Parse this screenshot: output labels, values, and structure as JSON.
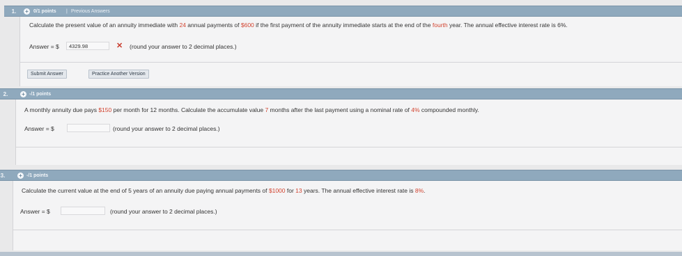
{
  "questions": [
    {
      "number": "1.",
      "points": "0/1 points",
      "separator": "|",
      "previous_answers": "Previous Answers",
      "text_parts": [
        "Calculate the present value of an annuity immediate with ",
        "24",
        " annual payments of ",
        "$600",
        " if the first payment of the annuity immediate starts at the end of the ",
        "fourth",
        " year. The annual effective interest rate is 6%."
      ],
      "answer_label": "Answer = $",
      "answer_value": "4329.98",
      "answer_status": "incorrect",
      "hint": "(round your answer to 2 decimal places.)",
      "submit_label": "Submit Answer",
      "practice_label": "Practice Another Version"
    },
    {
      "number": "2.",
      "points": "-/1 points",
      "text_parts": [
        "A monthly annuity due pays ",
        "$150",
        " per month for 12 months. Calculate the accumulate value ",
        "7",
        " months after the last payment using a nominal rate of ",
        "4%",
        " compounded monthly."
      ],
      "answer_label": "Answer = $",
      "answer_value": "",
      "hint": "(round your answer to 2 decimal places.)"
    },
    {
      "number": "3.",
      "points": "-/1 points",
      "text_parts": [
        "Calculate the current value at the end of 5 years of an annuity due paying annual payments of ",
        "$1000",
        " for ",
        "13",
        " years. The annual effective interest rate is ",
        "8%",
        "."
      ],
      "answer_label": "Answer = $",
      "answer_value": "",
      "hint": "(round your answer to 2 decimal places.)"
    }
  ],
  "icons": {
    "expand": "plus-circle-icon",
    "wrong": "x-mark-icon"
  },
  "colors": {
    "header_bar": "#8fa9bd",
    "highlight": "#d2432f"
  }
}
